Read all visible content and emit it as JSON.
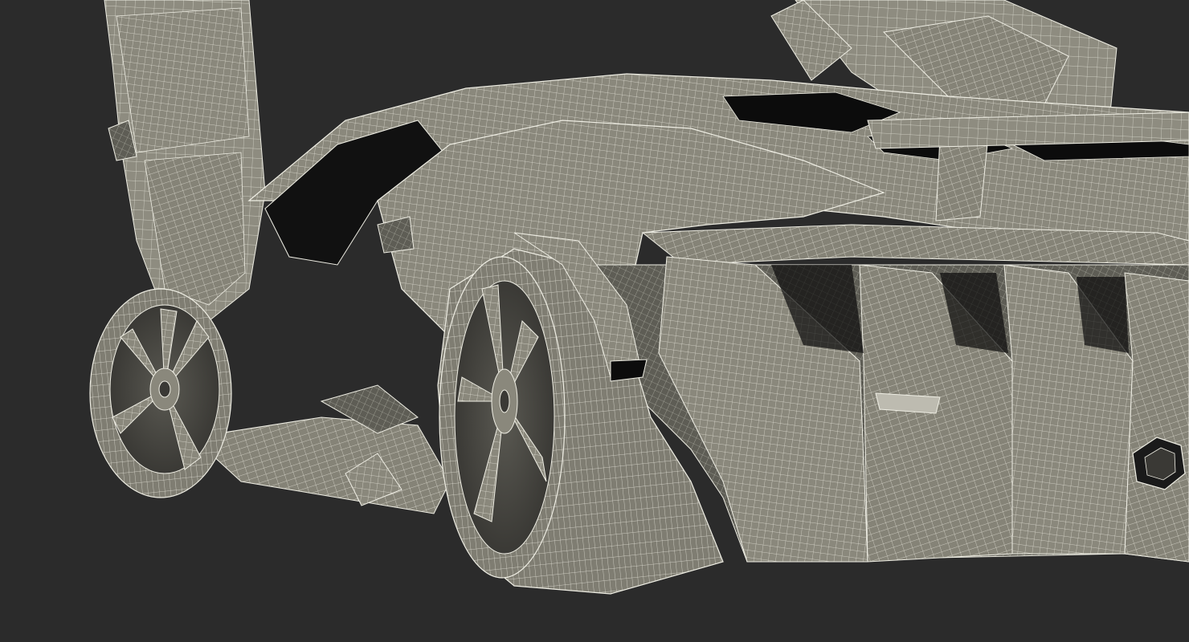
{
  "scene": {
    "subject": "",
    "background_color": "#2b2b2b",
    "surface_color": "#8a887c",
    "surface_shadow_color": "#5e5d55",
    "wire_color": "#efeee4",
    "cavity_color": "#0c0c0c"
  },
  "icons": {
    "wheel_front": "wheel-icon",
    "wheel_rear": "wheel-icon"
  }
}
